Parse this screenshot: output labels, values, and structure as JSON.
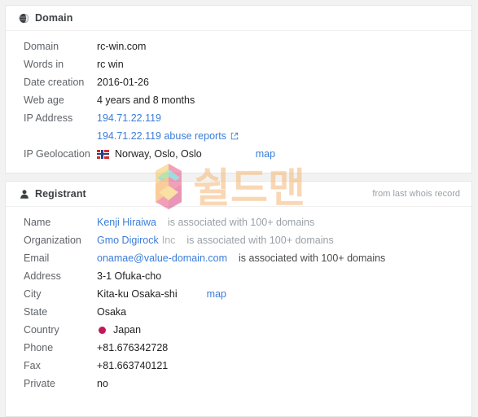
{
  "domain_card": {
    "icon": "globe-icon",
    "title": "Domain",
    "rows": [
      {
        "label": "Domain",
        "value": "rc-win.com"
      },
      {
        "label": "Words in",
        "value": "rc win"
      },
      {
        "label": "Date creation",
        "value": "2016-01-26"
      },
      {
        "label": "Web age",
        "value": "4 years and 8 months"
      },
      {
        "label": "IP Address",
        "value": "194.71.22.119"
      }
    ],
    "abuse_row": {
      "label": "",
      "link_text": "194.71.22.119 abuse reports",
      "icon": "external-link-icon"
    },
    "geolocation_row": {
      "label": "IP Geolocation",
      "flag": "norway-flag",
      "value": "Norway, Oslo, Oslo",
      "map_label": "map"
    }
  },
  "registrant_card": {
    "icon": "user-icon",
    "title": "Registrant",
    "note": "from last whois record",
    "rows": [
      {
        "label": "Name",
        "value": "Kenji Hiraiwa",
        "suffix": "",
        "assoc": "is associated with 100+ domains"
      },
      {
        "label": "Organization",
        "value": "Gmo Digirock",
        "suffix": "Inc",
        "assoc": "is associated with 100+ domains"
      },
      {
        "label": "Email",
        "value": "onamae@value-domain.com",
        "suffix": "",
        "assoc": "is associated with 100+ domains"
      }
    ],
    "address_row": {
      "label": "Address",
      "value": "3-1 Ofuka-cho"
    },
    "city_row": {
      "label": "City",
      "value": "Kita-ku Osaka-shi",
      "map_label": "map"
    },
    "state_row": {
      "label": "State",
      "value": "Osaka"
    },
    "country_row": {
      "label": "Country",
      "flag": "japan-flag",
      "value": "Japan"
    },
    "phone_row": {
      "label": "Phone",
      "value": "+81.676342728"
    },
    "fax_row": {
      "label": "Fax",
      "value": "+81.663740121"
    },
    "private_row": {
      "label": "Private",
      "value": "no"
    }
  },
  "watermark": {
    "logo": "shieldman-s-logo",
    "text": "쉴드맨",
    "color": "#f5b877"
  },
  "colors": {
    "link": "#3b7dd8",
    "label": "#5f6368",
    "muted": "#9aa0a6",
    "card_bg": "#ffffff",
    "page_bg": "#f2f2f2"
  }
}
